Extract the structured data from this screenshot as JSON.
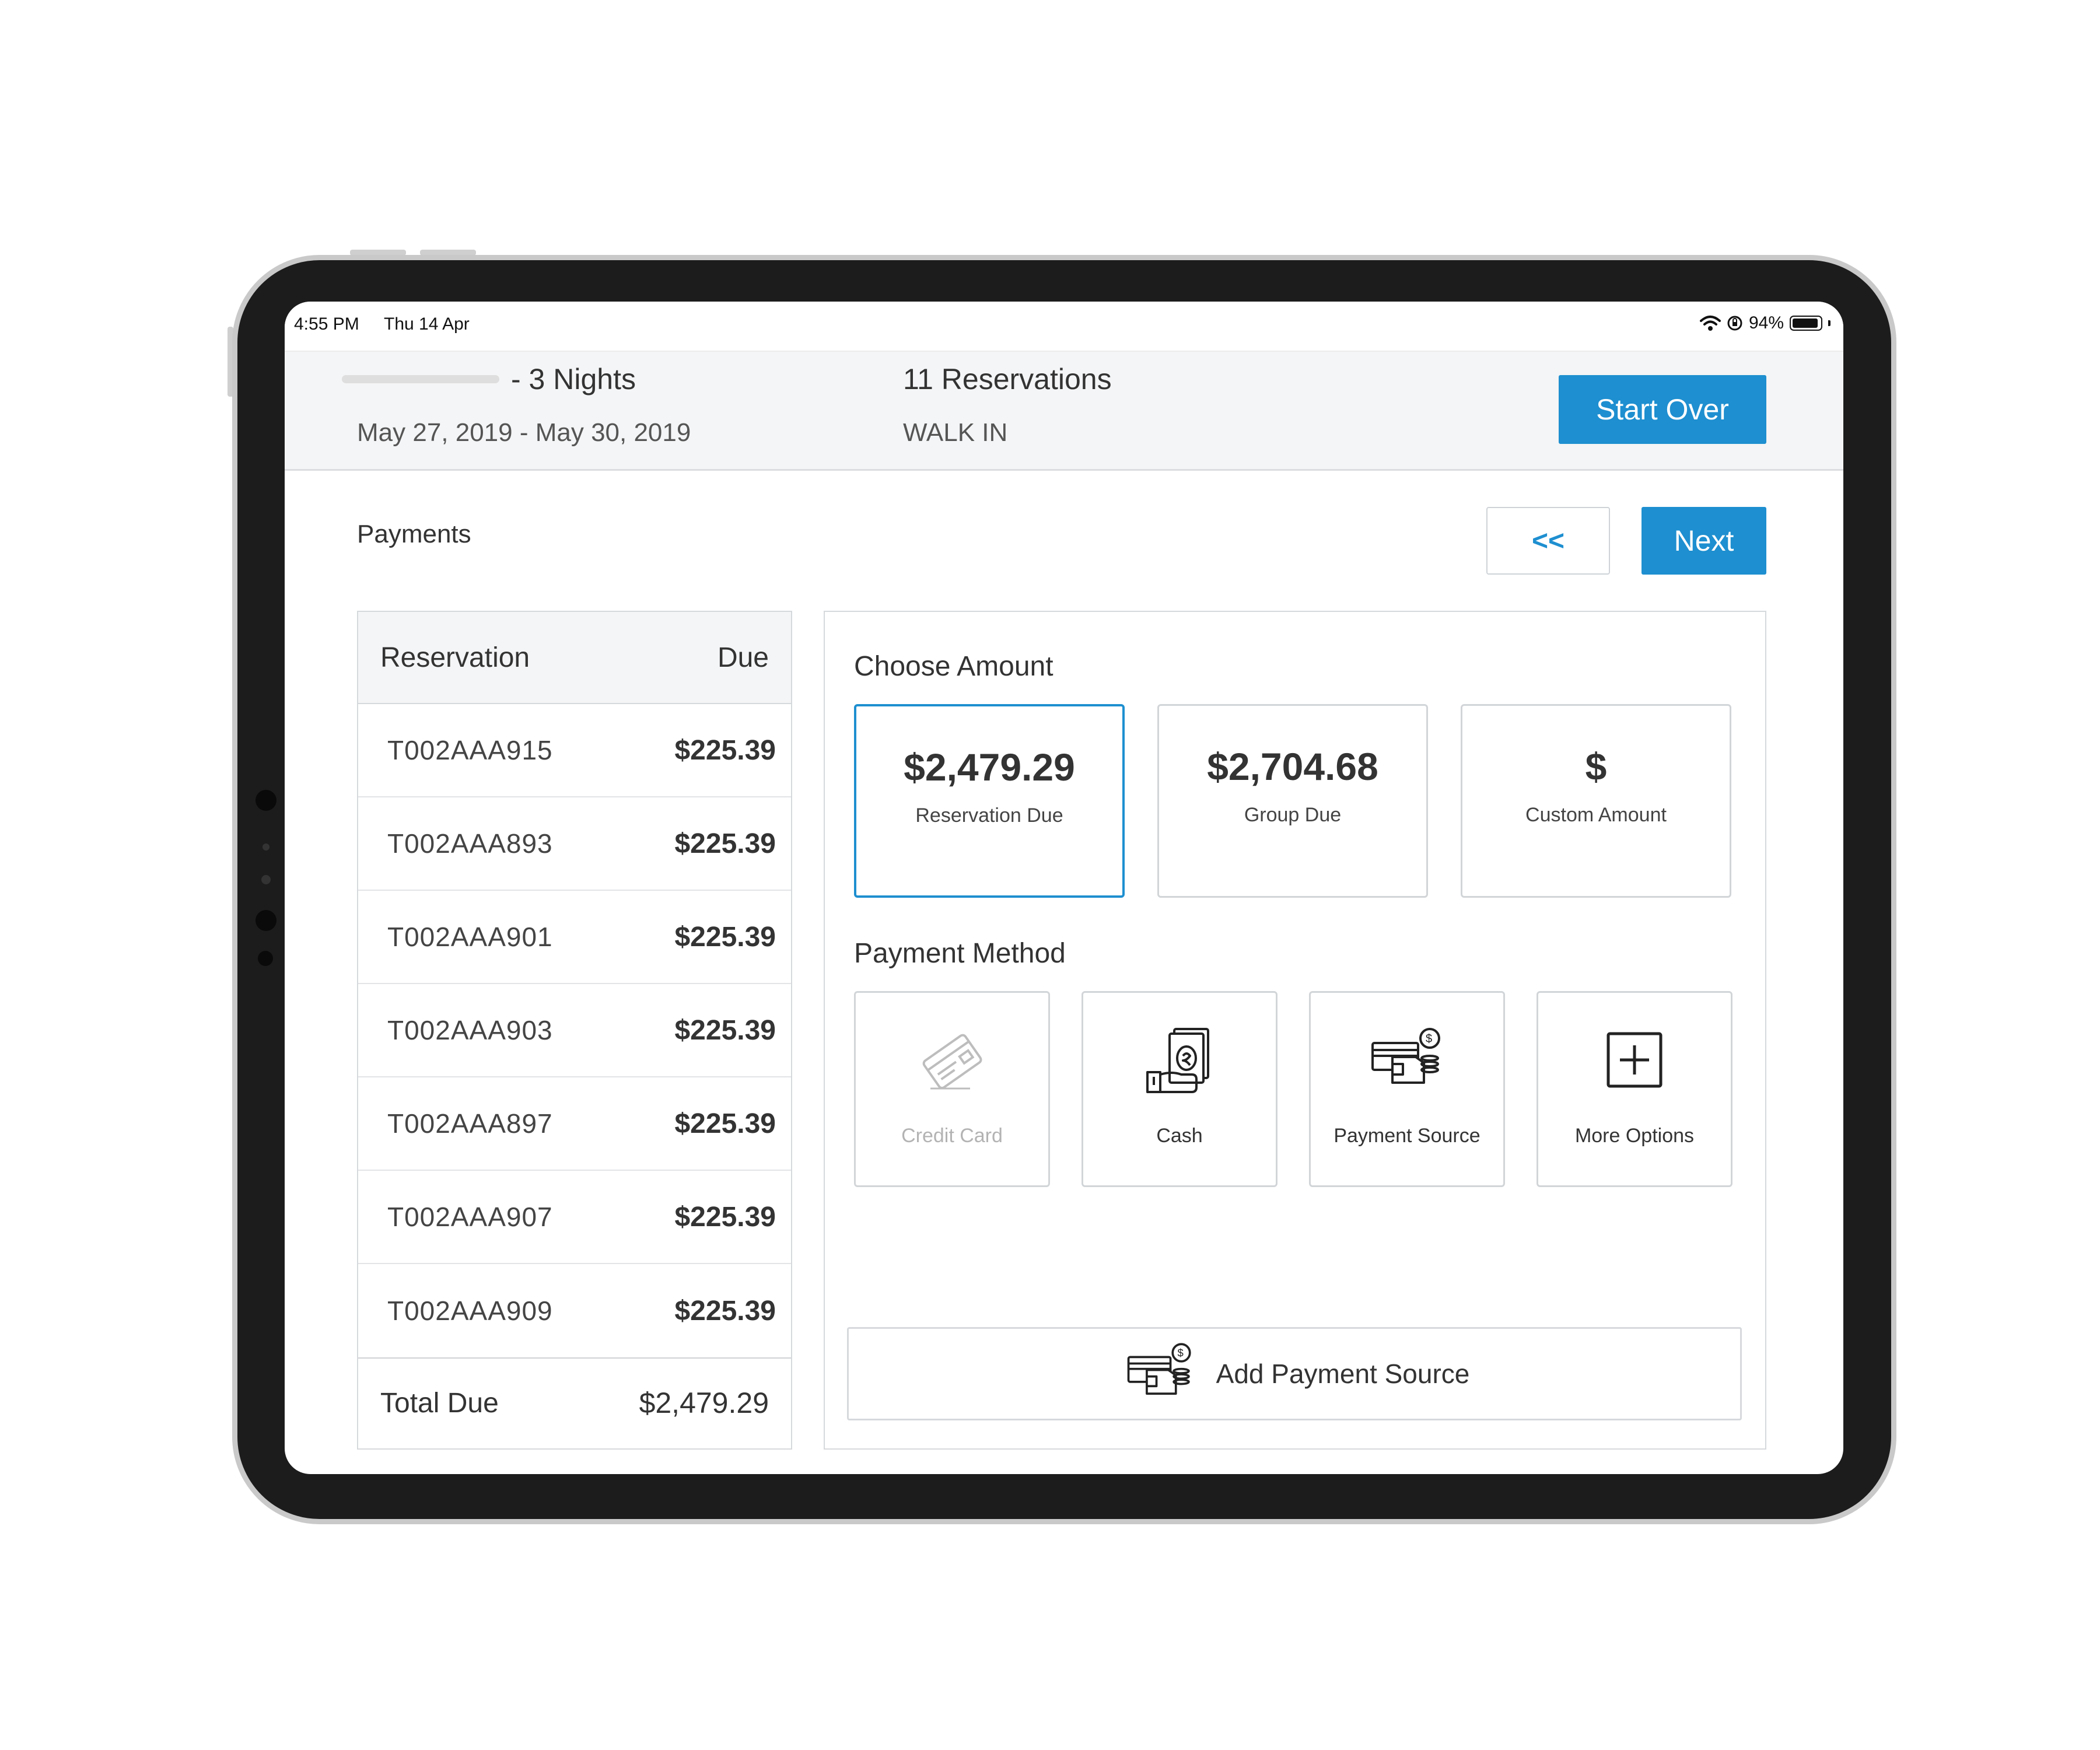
{
  "status_bar": {
    "time": "4:55 PM",
    "date": "Thu 14 Apr",
    "battery": "94%",
    "battery_level": 0.94
  },
  "header": {
    "nights": "- 3 Nights",
    "dates": "May 27, 2019 - May 30, 2019",
    "reservations_count": "11 Reservations",
    "source": "WALK IN",
    "start_over_label": "Start Over"
  },
  "page": {
    "title": "Payments",
    "back_label": "<<",
    "next_label": "Next"
  },
  "table": {
    "col_reservation": "Reservation",
    "col_due": "Due",
    "rows": [
      {
        "id": "T002AAA915",
        "due": "$225.39"
      },
      {
        "id": "T002AAA893",
        "due": "$225.39"
      },
      {
        "id": "T002AAA901",
        "due": "$225.39"
      },
      {
        "id": "T002AAA903",
        "due": "$225.39"
      },
      {
        "id": "T002AAA897",
        "due": "$225.39"
      },
      {
        "id": "T002AAA907",
        "due": "$225.39"
      },
      {
        "id": "T002AAA909",
        "due": "$225.39"
      }
    ],
    "total_label": "Total Due",
    "total_value": "$2,479.29"
  },
  "choose_amount": {
    "title": "Choose Amount",
    "options": [
      {
        "value": "$2,479.29",
        "label": "Reservation Due",
        "selected": true
      },
      {
        "value": "$2,704.68",
        "label": "Group Due",
        "selected": false
      },
      {
        "value": "$",
        "label": "Custom Amount",
        "selected": false
      }
    ]
  },
  "payment_method": {
    "title": "Payment Method",
    "options": [
      {
        "label": "Credit Card",
        "icon": "credit-card-icon",
        "disabled": true
      },
      {
        "label": "Cash",
        "icon": "cash-icon",
        "disabled": false
      },
      {
        "label": "Payment Source",
        "icon": "payment-source-icon",
        "disabled": false
      },
      {
        "label": "More Options",
        "icon": "plus-square-icon",
        "disabled": false
      }
    ]
  },
  "add_source": {
    "label": "Add Payment Source",
    "icon": "payment-source-icon"
  },
  "colors": {
    "accent": "#1e8fd0",
    "border": "#d6d9dc",
    "header_bg": "#f4f5f6"
  }
}
